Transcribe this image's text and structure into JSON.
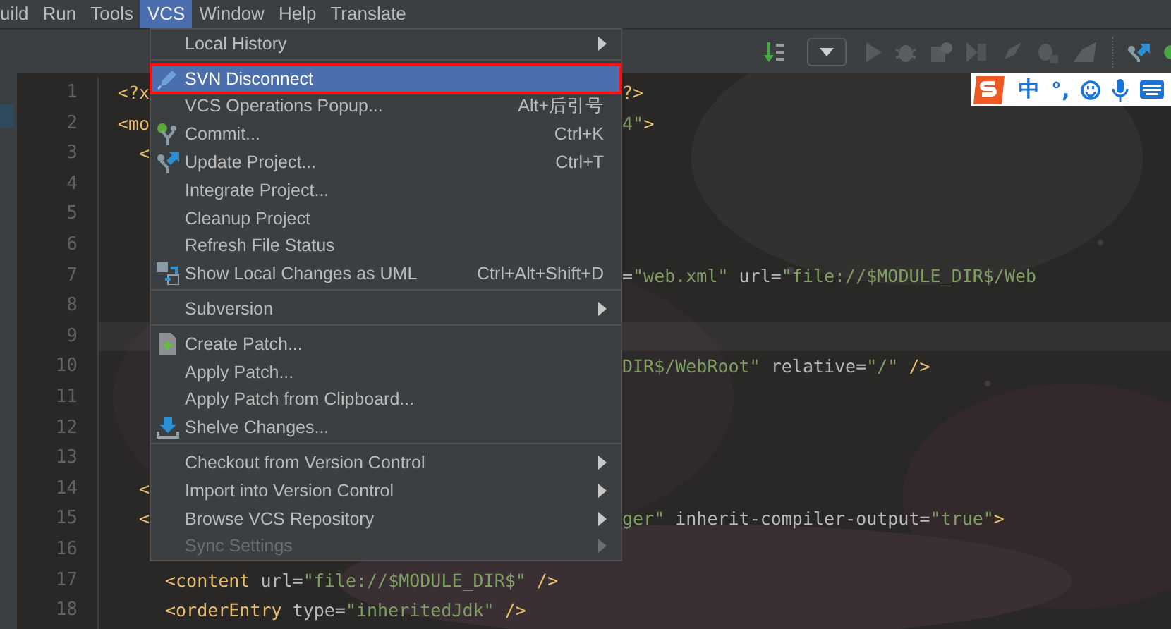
{
  "menubar": [
    {
      "label": "uild",
      "selected": false
    },
    {
      "label": "Run",
      "selected": false
    },
    {
      "label": "Tools",
      "selected": false
    },
    {
      "label": "VCS",
      "selected": true
    },
    {
      "label": "Window",
      "selected": false
    },
    {
      "label": "Help",
      "selected": false
    },
    {
      "label": "Translate",
      "selected": false
    }
  ],
  "ime_bar": {
    "mode": "中",
    "punctuation": "°,"
  },
  "editor": {
    "lines": [
      {
        "number": "1",
        "left": [
          {
            "kind": "tag",
            "text": "<?x"
          }
        ],
        "right": [
          {
            "kind": "tag",
            "text": "?>"
          }
        ]
      },
      {
        "number": "2",
        "left": [
          {
            "kind": "tag",
            "text": "<mo"
          }
        ],
        "right": [
          {
            "kind": "value",
            "text": "4\""
          },
          {
            "kind": "tag",
            "text": ">"
          }
        ]
      },
      {
        "number": "3",
        "left": [
          {
            "kind": "tag",
            "text": "<"
          }
        ]
      },
      {
        "number": "4"
      },
      {
        "number": "5"
      },
      {
        "number": "6"
      },
      {
        "number": "7",
        "right": [
          {
            "kind": "attr",
            "text": "="
          },
          {
            "kind": "value",
            "text": "\"web.xml\""
          },
          {
            "kind": "attr",
            "text": " url="
          },
          {
            "kind": "value",
            "text": "\"file://$MODULE_DIR$/Web"
          }
        ]
      },
      {
        "number": "8"
      },
      {
        "number": "9",
        "highlighted": true
      },
      {
        "number": "10",
        "right": [
          {
            "kind": "value",
            "text": "DIR$/WebRoot\""
          },
          {
            "kind": "attr",
            "text": " relative="
          },
          {
            "kind": "value",
            "text": "\"/\""
          },
          {
            "kind": "tag",
            "text": " />"
          }
        ]
      },
      {
        "number": "11"
      },
      {
        "number": "12"
      },
      {
        "number": "13"
      },
      {
        "number": "14",
        "left": [
          {
            "kind": "tag",
            "text": "<"
          }
        ]
      },
      {
        "number": "15",
        "left": [
          {
            "kind": "tag",
            "text": "<"
          }
        ],
        "right": [
          {
            "kind": "value",
            "text": "ger\""
          },
          {
            "kind": "attr",
            "text": " inherit-compiler-output="
          },
          {
            "kind": "value",
            "text": "\"true\""
          },
          {
            "kind": "tag",
            "text": ">"
          }
        ]
      },
      {
        "number": "16"
      },
      {
        "number": "17",
        "full": [
          {
            "kind": "tag",
            "text": "<content"
          },
          {
            "kind": "attr",
            "text": " url="
          },
          {
            "kind": "value",
            "text": "\"file://$MODULE_DIR$\""
          },
          {
            "kind": "tag",
            "text": " />"
          }
        ]
      },
      {
        "number": "18",
        "full": [
          {
            "kind": "tag",
            "text": "<orderEntry"
          },
          {
            "kind": "attr",
            "text": " type="
          },
          {
            "kind": "value",
            "text": "\"inheritedJdk\""
          },
          {
            "kind": "tag",
            "text": " />"
          }
        ]
      }
    ]
  },
  "vcs_menu": [
    {
      "kind": "item",
      "label": "Local History",
      "submenu": true,
      "selected": false,
      "disabled": false
    },
    {
      "kind": "separator"
    },
    {
      "kind": "item",
      "label": "SVN Disconnect",
      "selected": true,
      "outlined": true,
      "disabled": false
    },
    {
      "kind": "item",
      "label": "VCS Operations Popup...",
      "shortcut": "Alt+后引号",
      "selected": false,
      "disabled": false
    },
    {
      "kind": "item",
      "label": "Commit...",
      "shortcut": "Ctrl+K",
      "selected": false,
      "disabled": false
    },
    {
      "kind": "item",
      "label": "Update Project...",
      "shortcut": "Ctrl+T",
      "selected": false,
      "disabled": false
    },
    {
      "kind": "item",
      "label": "Integrate Project...",
      "selected": false,
      "disabled": false
    },
    {
      "kind": "item",
      "label": "Cleanup Project",
      "selected": false,
      "disabled": false
    },
    {
      "kind": "item",
      "label": "Refresh File Status",
      "selected": false,
      "disabled": false
    },
    {
      "kind": "item",
      "label": "Show Local Changes as UML",
      "shortcut": "Ctrl+Alt+Shift+D",
      "selected": false,
      "disabled": false
    },
    {
      "kind": "separator"
    },
    {
      "kind": "item",
      "label": "Subversion",
      "submenu": true,
      "selected": false,
      "disabled": false
    },
    {
      "kind": "separator"
    },
    {
      "kind": "item",
      "label": "Create Patch...",
      "selected": false,
      "disabled": false
    },
    {
      "kind": "item",
      "label": "Apply Patch...",
      "selected": false,
      "disabled": false
    },
    {
      "kind": "item",
      "label": "Apply Patch from Clipboard...",
      "selected": false,
      "disabled": false
    },
    {
      "kind": "item",
      "label": "Shelve Changes...",
      "selected": false,
      "disabled": false
    },
    {
      "kind": "separator"
    },
    {
      "kind": "item",
      "label": "Checkout from Version Control",
      "submenu": true,
      "selected": false,
      "disabled": false
    },
    {
      "kind": "item",
      "label": "Import into Version Control",
      "submenu": true,
      "selected": false,
      "disabled": false
    },
    {
      "kind": "item",
      "label": "Browse VCS Repository",
      "submenu": true,
      "selected": false,
      "disabled": false
    },
    {
      "kind": "item",
      "label": "Sync Settings",
      "submenu": true,
      "selected": false,
      "disabled": true
    }
  ]
}
